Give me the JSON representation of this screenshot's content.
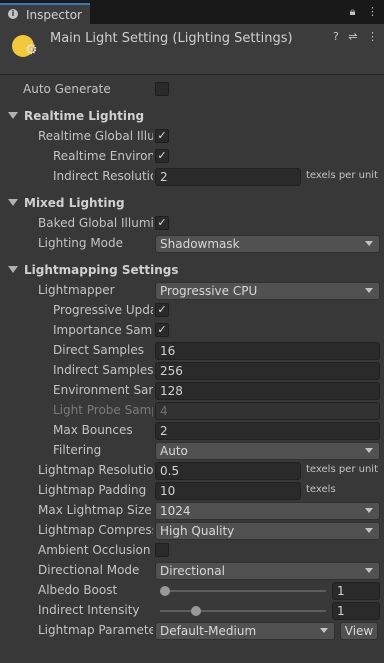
{
  "tab": {
    "title": "Inspector"
  },
  "header": {
    "title": "Main Light Setting (Lighting Settings)"
  },
  "auto_generate": {
    "label": "Auto Generate",
    "checked": false
  },
  "realtime": {
    "title": "Realtime Lighting",
    "global_illum": {
      "label": "Realtime Global Illum",
      "checked": true
    },
    "env": {
      "label": "Realtime Environn",
      "checked": true
    },
    "indirect_res": {
      "label": "Indirect Resolution",
      "value": "2",
      "unit": "texels per unit"
    }
  },
  "mixed": {
    "title": "Mixed Lighting",
    "baked": {
      "label": "Baked Global Illumin",
      "checked": true
    },
    "mode": {
      "label": "Lighting Mode",
      "value": "Shadowmask"
    }
  },
  "lightmapping": {
    "title": "Lightmapping Settings",
    "lightmapper": {
      "label": "Lightmapper",
      "value": "Progressive CPU"
    },
    "progressive_updates": {
      "label": "Progressive Upda",
      "checked": true
    },
    "importance_sampling": {
      "label": "Importance Sampl",
      "checked": true
    },
    "direct_samples": {
      "label": "Direct Samples",
      "value": "16"
    },
    "indirect_samples": {
      "label": "Indirect Samples",
      "value": "256"
    },
    "environment_samples": {
      "label": "Environment Samp",
      "value": "128"
    },
    "light_probe_samples": {
      "label": "Light Probe Samp",
      "value": "4"
    },
    "max_bounces": {
      "label": "Max Bounces",
      "value": "2"
    },
    "filtering": {
      "label": "Filtering",
      "value": "Auto"
    },
    "resolution": {
      "label": "Lightmap Resolution",
      "value": "0.5",
      "unit": "texels per unit"
    },
    "padding": {
      "label": "Lightmap Padding",
      "value": "10",
      "unit": "texels"
    },
    "max_size": {
      "label": "Max Lightmap Size",
      "value": "1024"
    },
    "compression": {
      "label": "Lightmap Compressi",
      "value": "High Quality"
    },
    "ambient_occlusion": {
      "label": "Ambient Occlusion",
      "checked": false
    },
    "directional_mode": {
      "label": "Directional Mode",
      "value": "Directional"
    },
    "albedo_boost": {
      "label": "Albedo Boost",
      "value": "1",
      "fraction": 0.0
    },
    "indirect_intensity": {
      "label": "Indirect Intensity",
      "value": "1",
      "fraction": 0.2
    },
    "parameters": {
      "label": "Lightmap Parameters",
      "value": "Default-Medium",
      "button": "View"
    }
  },
  "icons": {
    "tab": [
      "info-icon",
      "lock-icon",
      "kebab-menu-icon"
    ],
    "header": [
      "help-icon",
      "preset-icon",
      "menu-icon"
    ]
  },
  "colors": {
    "accent": "#3a79bb",
    "bulb": "#f2c93c",
    "background": "#383838"
  }
}
